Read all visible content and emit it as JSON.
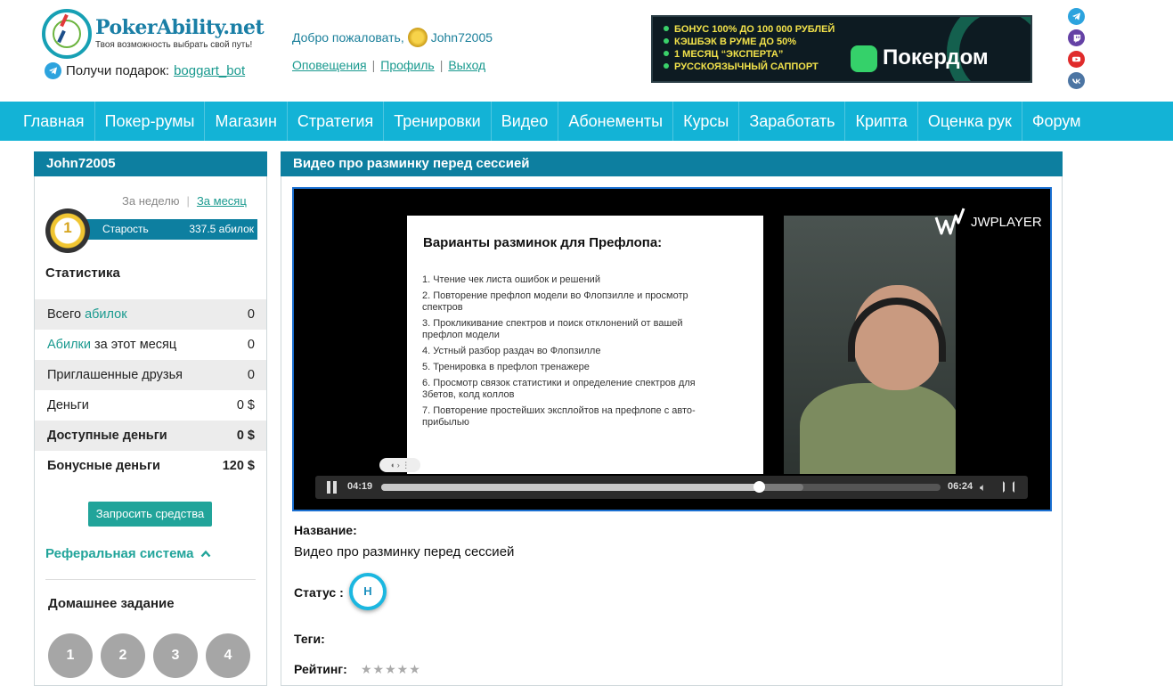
{
  "header": {
    "logo_title": "PokerAbility.net",
    "logo_subtitle": "Твоя возможность выбрать свой путь!",
    "gift_text": "Получи подарок:",
    "gift_link": "boggart_bot",
    "welcome_text": "Добро пожаловать,",
    "username": "John72005",
    "links": [
      "Оповещения",
      "Профиль",
      "Выход"
    ],
    "banner": {
      "lines": [
        "БОНУС 100% ДО 100 000 РУБЛЕЙ",
        "КЭШБЭК В РУМЕ ДО 50%",
        "1 МЕСЯЦ “ЭКСПЕРТА”",
        "РУССКОЯЗЫЧНЫЙ САППОРТ"
      ],
      "brand": "Покердом"
    },
    "social_icons": [
      "telegram-icon",
      "twitch-icon",
      "youtube-icon",
      "vk-icon"
    ]
  },
  "nav": [
    "Главная",
    "Покер-румы",
    "Магазин",
    "Стратегия",
    "Тренировки",
    "Видео",
    "Абонементы",
    "Курсы",
    "Заработать",
    "Крипта",
    "Оценка рук",
    "Форум"
  ],
  "sidebar": {
    "title": "John72005",
    "period_week": "За неделю",
    "period_month": "За месяц",
    "rank_number": "1",
    "rank_label": "Старость",
    "rank_value": "337.5 абилок",
    "stats_title": "Статистика",
    "stats": [
      {
        "pre": "Всего ",
        "link": "абилок",
        "post": "",
        "value": "0"
      },
      {
        "pre": "",
        "link": "Абилки",
        "post": " за этот месяц",
        "value": "0"
      },
      {
        "pre": "Приглашенные друзья",
        "link": "",
        "post": "",
        "value": "0"
      },
      {
        "pre": "Деньги",
        "link": "",
        "post": "",
        "value": "0 $"
      },
      {
        "pre": "Доступные деньги",
        "link": "",
        "post": "",
        "value": "0 $"
      },
      {
        "pre": "Бонусные деньги",
        "link": "",
        "post": "",
        "value": "120 $"
      }
    ],
    "request_button": "Запросить средства",
    "referral": "Реферальная система",
    "homework_title": "Домашнее задание",
    "homework": [
      "1",
      "2",
      "3",
      "4"
    ]
  },
  "main": {
    "title": "Видео про разминку перед сессией",
    "slide_title": "Варианты разминок для Префлопа:",
    "slide_items": [
      "1. Чтение чек листа ошибок и решений",
      "2. Повторение префлоп модели  во Флопзилле  и просмотр спектров",
      "3. Прокликивание спектров и поиск отклонений от вашей префлоп модели",
      "4. Устный разбор раздач во Флопзилле",
      "5. Тренировка в префлоп тренажере",
      "6. Просмотр связок статистики и определение спектров для 3бетов, колд коллов",
      "7. Повторение простейших эксплойтов на префлопе с авто-прибылью"
    ],
    "player_brand": "JWPLAYER",
    "time_current": "04:19",
    "time_total": "06:24",
    "progress": 0.675,
    "buffered": 0.755,
    "name_label": "Название:",
    "name_value": "Видео про разминку перед сессией",
    "status_label": "Статус :",
    "status_badge": "Н",
    "tags_label": "Теги:",
    "rating_label": "Рейтинг:",
    "rating_stars": "★★★★★"
  }
}
